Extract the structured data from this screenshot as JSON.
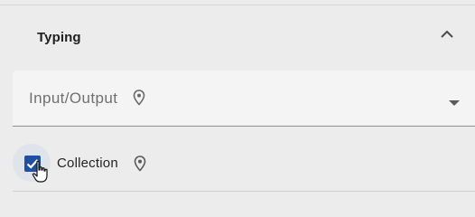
{
  "panel": {
    "title": "Typing",
    "expanded": true,
    "collapse_icon": "chevron-up-icon"
  },
  "select": {
    "label": "Input/Output",
    "pin_icon": "location-pin-icon",
    "dropdown_icon": "caret-down-icon"
  },
  "checkbox": {
    "label": "Collection",
    "checked": true,
    "pin_icon": "location-pin-icon"
  },
  "colors": {
    "accent": "#1f4fa3",
    "background": "#ececec",
    "field_background": "#f4f4f4"
  }
}
